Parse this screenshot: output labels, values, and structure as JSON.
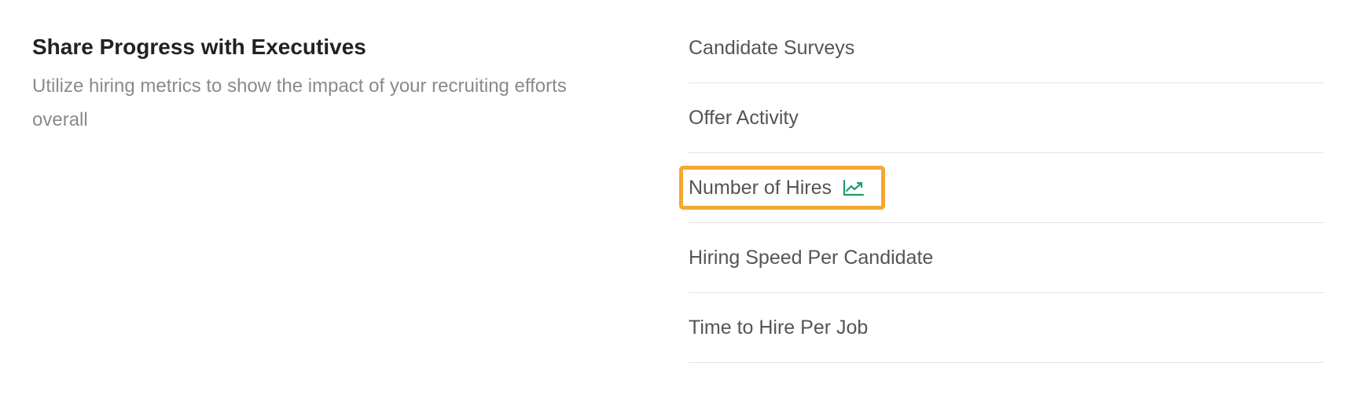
{
  "section": {
    "title": "Share Progress with Executives",
    "description": "Utilize hiring metrics to show the impact of your recruiting efforts overall"
  },
  "reports": {
    "items": [
      {
        "label": "Candidate Surveys",
        "icon": null
      },
      {
        "label": "Offer Activity",
        "icon": null
      },
      {
        "label": "Number of Hires",
        "icon": "trend-chart-icon",
        "highlighted": true
      },
      {
        "label": "Hiring Speed Per Candidate",
        "icon": null
      },
      {
        "label": "Time to Hire Per Job",
        "icon": null
      }
    ]
  },
  "colors": {
    "highlight": "#f5a733",
    "icon_accent": "#1f9a6a",
    "title": "#222222",
    "description": "#8a8a8a",
    "item_text": "#555555",
    "divider": "#e3e3e3"
  }
}
